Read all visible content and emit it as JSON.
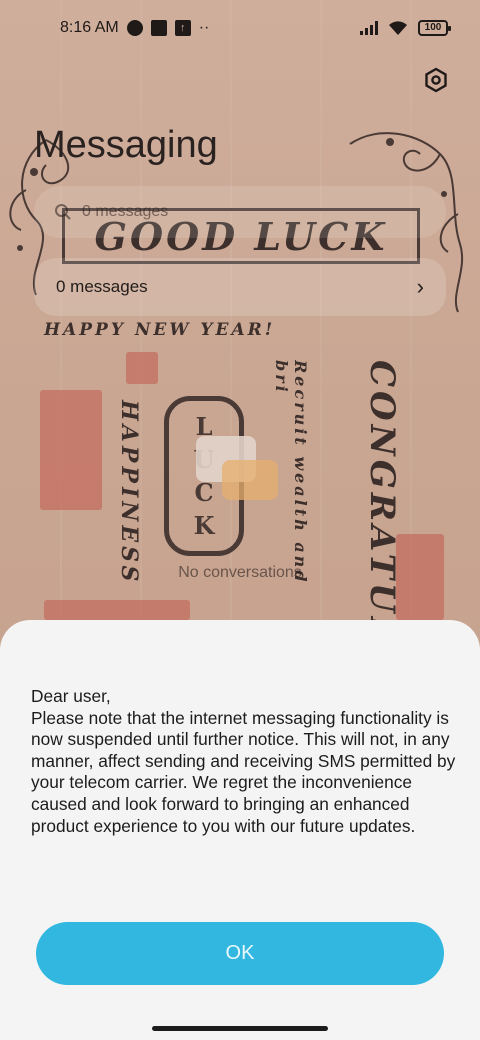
{
  "status_bar": {
    "time": "8:16 AM",
    "battery": "100"
  },
  "header": {
    "title": "Messaging",
    "settings_icon": "settings-icon"
  },
  "search": {
    "placeholder": "0 messages"
  },
  "summary": {
    "label": "0 messages"
  },
  "wallpaper": {
    "good_luck": "GOOD LUCK",
    "happy_new_year": "HAPPY NEW YEAR!",
    "happiness": "HAPPINESS",
    "recruit": "Recruit wealth and bri",
    "congrat": "CONGRATUL",
    "luck": [
      "L",
      "U",
      "C",
      "K"
    ]
  },
  "empty_state": {
    "text": "No conversations"
  },
  "dialog": {
    "message": "Dear user,\nPlease note that the internet messaging functionality is now suspended until further notice. This will not, in any manner, affect sending and receiving SMS permitted by your telecom carrier. We regret the inconvenience caused and look forward to bringing an enhanced product experience to you with our future updates.",
    "ok_label": "OK"
  },
  "colors": {
    "accent": "#32b8e0",
    "sheet": "#f4f4f4"
  }
}
